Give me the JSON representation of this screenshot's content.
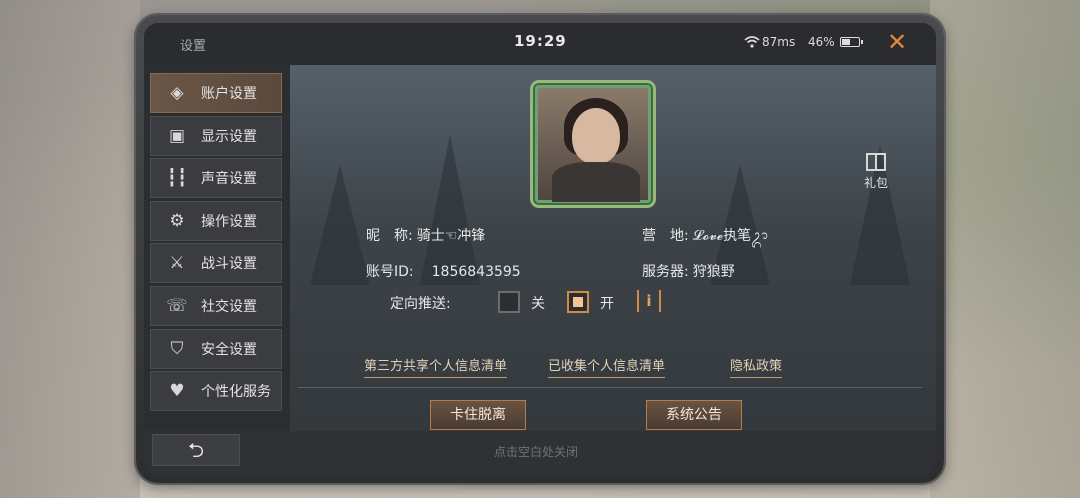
{
  "status": {
    "title": "设置",
    "time": "19:29",
    "ping": "87ms",
    "battery_pct": "46%",
    "battery_level": 0.46,
    "close_icon": "close-icon"
  },
  "sidebar": {
    "items": [
      {
        "label": "账户设置",
        "icon": "account-icon",
        "active": true
      },
      {
        "label": "显示设置",
        "icon": "display-icon",
        "active": false
      },
      {
        "label": "声音设置",
        "icon": "sound-icon",
        "active": false
      },
      {
        "label": "操作设置",
        "icon": "controls-icon",
        "active": false
      },
      {
        "label": "战斗设置",
        "icon": "combat-icon",
        "active": false
      },
      {
        "label": "社交设置",
        "icon": "social-icon",
        "active": false
      },
      {
        "label": "安全设置",
        "icon": "security-icon",
        "active": false
      },
      {
        "label": "个性化服务",
        "icon": "personalize-icon",
        "active": false
      }
    ]
  },
  "account": {
    "nickname_label": "昵　称:",
    "nickname": "骑士☜冲锋",
    "camp_label": "营　地:",
    "camp": "𝓛𝓸𝓿𝓮执笔ᬊ",
    "id_label": "账号ID:",
    "id": "1856843595",
    "server_label": "服务器:",
    "server": "狩狼野",
    "push_label": "定向推送:",
    "push_off_label": "关",
    "push_on_label": "开",
    "push_selected": "开",
    "info_icon": "info-icon"
  },
  "gift": {
    "label": "礼包",
    "icon": "gift-icon"
  },
  "links": [
    {
      "label": "第三方共享个人信息清单"
    },
    {
      "label": "已收集个人信息清单"
    },
    {
      "label": "隐私政策"
    }
  ],
  "buttons": {
    "unstuck": "卡住脱离",
    "announcement": "系统公告"
  },
  "bottom": {
    "back_icon": "back-arrow-icon",
    "hint": "点击空白处关闭"
  },
  "colors": {
    "accent": "#d28a45",
    "active_tab": "#6a5646"
  }
}
